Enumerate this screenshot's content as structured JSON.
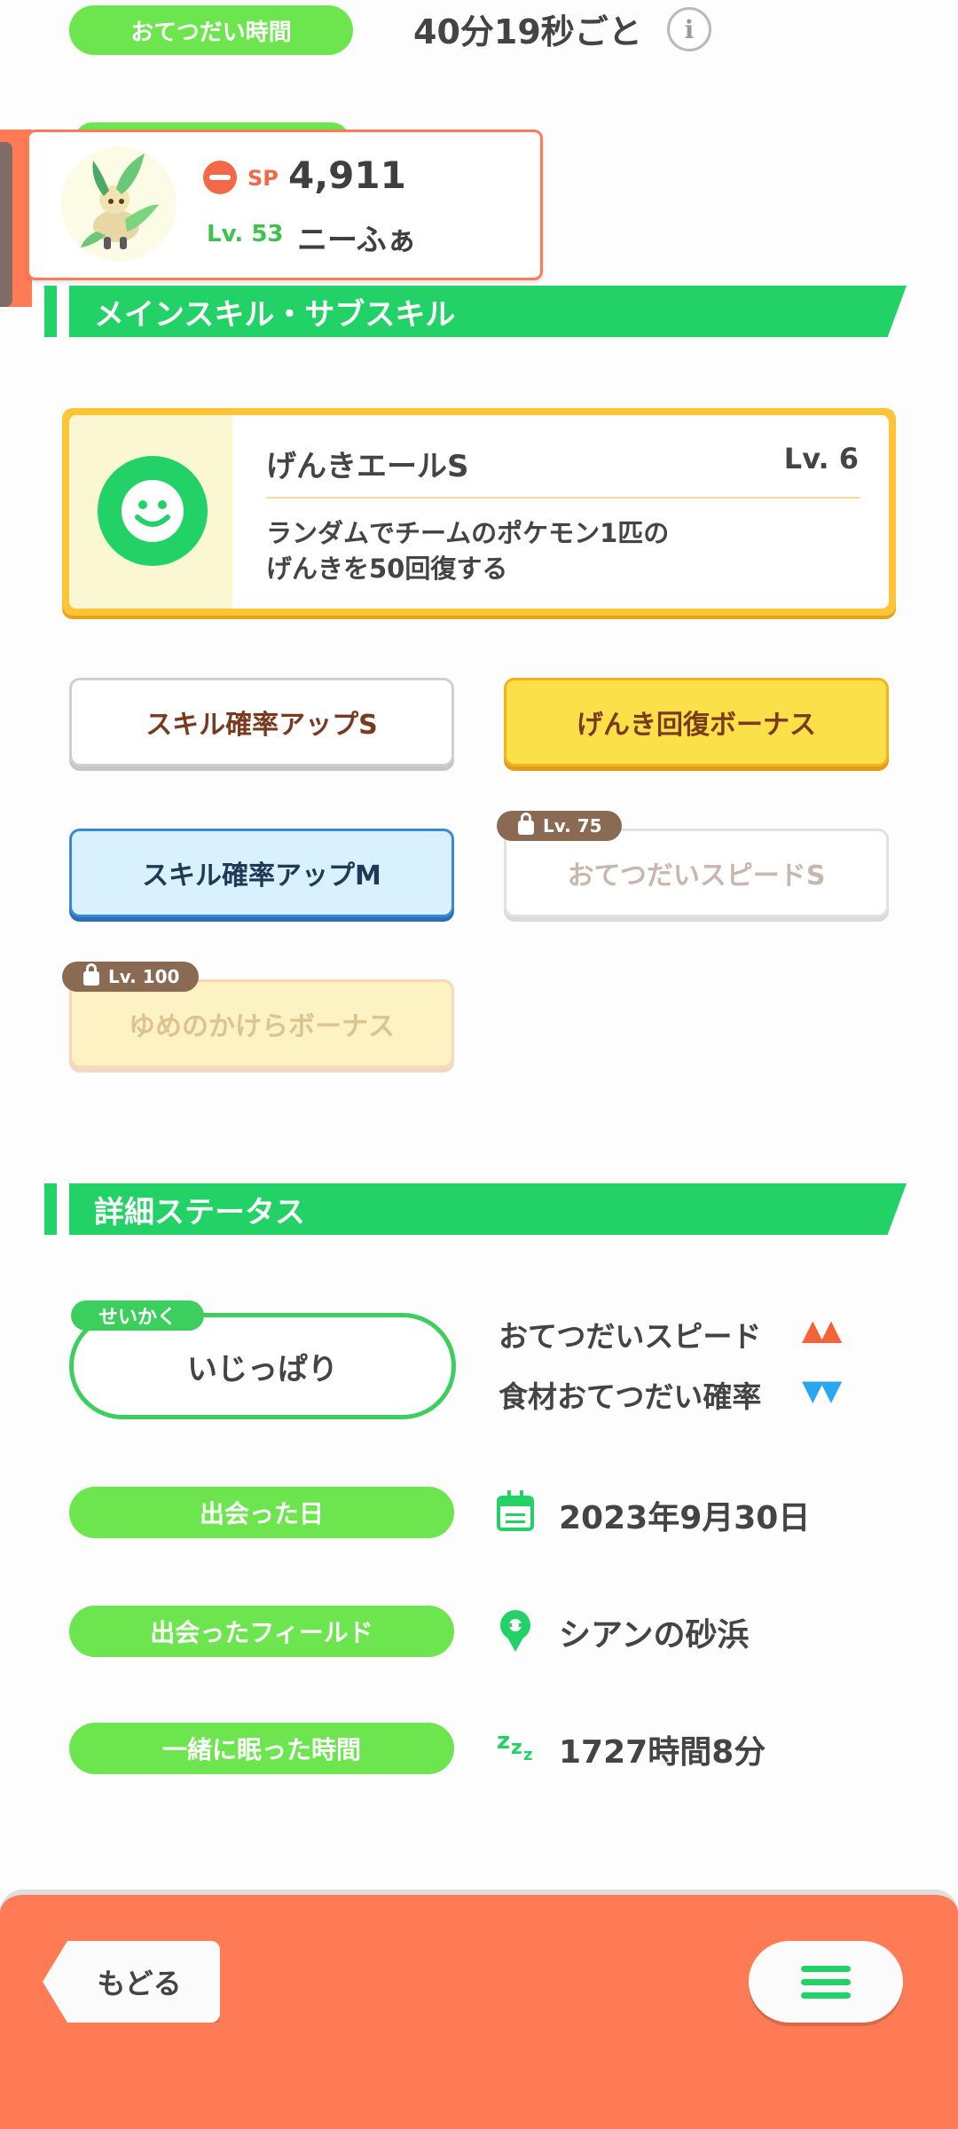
{
  "help_row": {
    "label": "おてつだい時間",
    "value": "40分19秒ごと",
    "info_icon": "info-icon"
  },
  "pokemon_card": {
    "sp_label": "SP",
    "sp_value": "4,911",
    "level": "Lv. 53",
    "name": "ニーふぁ"
  },
  "skills_section": {
    "title": "メインスキル・サブスキル",
    "main_skill": {
      "name": "げんきエールS",
      "level": "Lv. 6",
      "description_line1": "ランダムでチームのポケモン1匹の",
      "description_line2": "げんきを50回復する",
      "icon": "smiley-icon"
    },
    "sub_skills": [
      {
        "label": "スキル確率アップS",
        "locked": false
      },
      {
        "label": "げんき回復ボーナス",
        "locked": false
      },
      {
        "label": "スキル確率アップM",
        "locked": false
      },
      {
        "label": "おてつだいスピードS",
        "locked": true,
        "unlock_level": "Lv. 75"
      },
      {
        "label": "ゆめのかけらボーナス",
        "locked": true,
        "unlock_level": "Lv. 100"
      }
    ]
  },
  "details_section": {
    "title": "詳細ステータス",
    "nature": {
      "tag": "せいかく",
      "value": "いじっぱり",
      "up_stat": "おてつだいスピード",
      "down_stat": "食材おてつだい確率",
      "up_arrows": "▲▲",
      "down_arrows": "▼▼"
    },
    "met_date": {
      "label": "出会った日",
      "value": "2023年9月30日"
    },
    "met_field": {
      "label": "出会ったフィールド",
      "value": "シアンの砂浜"
    },
    "sleep_time": {
      "label": "一緒に眠った時間",
      "value": "1727時間8分"
    }
  },
  "footer": {
    "back_label": "もどる",
    "menu_icon": "hamburger-menu-icon"
  },
  "colors": {
    "green": "#22d266",
    "light_green": "#6ce54e",
    "orange": "#ff7b55",
    "up_arrow": "#f2633a",
    "down_arrow": "#2aa7f0"
  }
}
